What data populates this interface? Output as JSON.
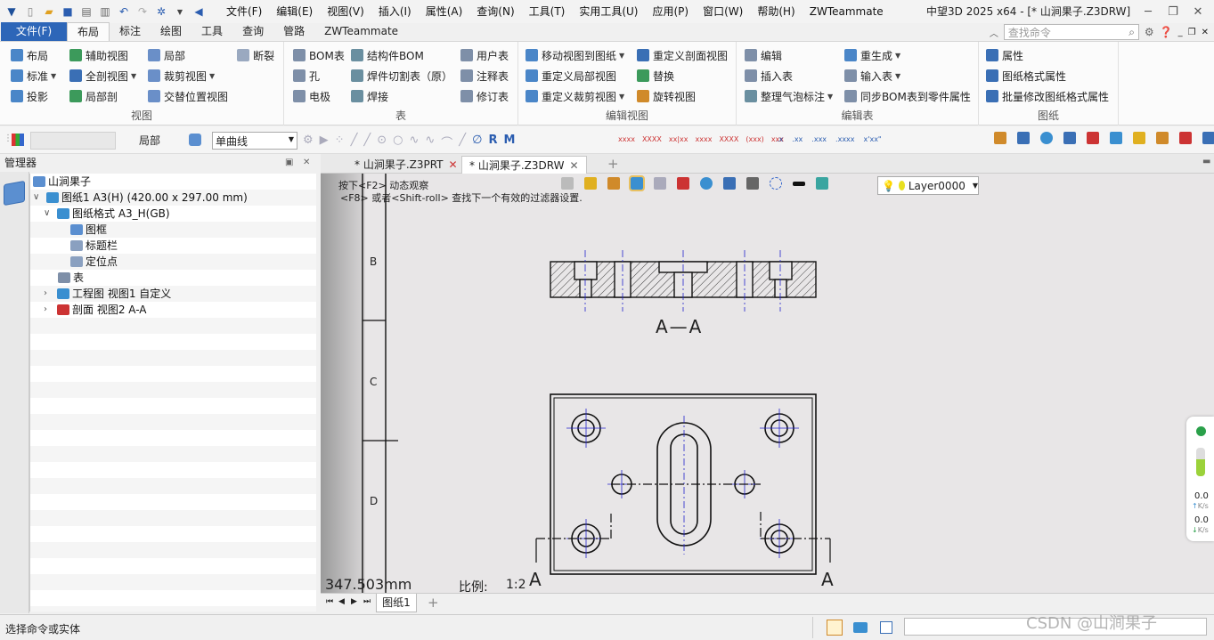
{
  "titlebar": {
    "menus": [
      "文件(F)",
      "编辑(E)",
      "视图(V)",
      "插入(I)",
      "属性(A)",
      "查询(N)",
      "工具(T)",
      "实用工具(U)",
      "应用(P)",
      "窗口(W)",
      "帮助(H)",
      "ZWTeammate"
    ],
    "doc_title": "中望3D 2025 x64 - [* 山涧果子.Z3DRW]"
  },
  "ribbon_tabs": [
    "文件(F)",
    "布局",
    "标注",
    "绘图",
    "工具",
    "查询",
    "管路",
    "ZWTeammate"
  ],
  "search": {
    "placeholder": "查找命令"
  },
  "ribbon": {
    "groups": [
      {
        "label": "视图",
        "items": [
          "布局",
          "辅助视图",
          "局部",
          "断裂",
          "标准",
          "全剖视图",
          "裁剪视图",
          "投影",
          "局部剖",
          "交替位置视图"
        ]
      },
      {
        "label": "表",
        "items": [
          "BOM表",
          "结构件BOM",
          "用户表",
          "孔",
          "焊件切割表（原）",
          "注释表",
          "电极",
          "焊接",
          "修订表"
        ]
      },
      {
        "label": "编辑视图",
        "items": [
          "移动视图到图纸",
          "重定义剖面视图",
          "重定义局部视图",
          "替换",
          "重定义裁剪视图",
          "旋转视图"
        ]
      },
      {
        "label": "编辑表",
        "items": [
          "编辑",
          "重生成",
          "插入表",
          "输入表",
          "整理气泡标注",
          "同步BOM表到零件属性"
        ]
      },
      {
        "label": "图纸",
        "items": [
          "属性",
          "图纸格式属性",
          "批量修改图纸格式属性"
        ]
      }
    ]
  },
  "toolbar2": {
    "local_label": "局部",
    "curve_type": "单曲线",
    "layer": "Layer0000"
  },
  "manager": {
    "title": "管理器",
    "tree": [
      {
        "label": "山涧果子"
      },
      {
        "label": "图纸1 A3(H) (420.00 x 297.00 mm)"
      },
      {
        "label": "图纸格式 A3_H(GB)"
      },
      {
        "label": "图框"
      },
      {
        "label": "标题栏"
      },
      {
        "label": "定位点"
      },
      {
        "label": "表"
      },
      {
        "label": "工程图 视图1 自定义"
      },
      {
        "label": "剖面 视图2 A-A"
      }
    ]
  },
  "doc_tabs": [
    "* 山涧果子.Z3PRT",
    "* 山涧果子.Z3DRW"
  ],
  "canvas": {
    "hint1": "按下<F2> 动态观察",
    "hint2": "<F8> 或者<Shift-roll> 查找下一个有效的过滤器设置.",
    "zone_labels": [
      "B",
      "C",
      "D"
    ],
    "section_label": "A—A",
    "cut_label_left": "A",
    "cut_label_right": "A",
    "measure": "347.503mm",
    "scale_label": "比例:",
    "scale_value": "1:2"
  },
  "sheet_tab": "图纸1",
  "status": {
    "text": "选择命令或实体"
  },
  "net": {
    "up_value": "0.0",
    "up_unit": "K/s",
    "down_value": "0.0",
    "down_unit": "K/s"
  },
  "watermark": "CSDN @山涧果子"
}
